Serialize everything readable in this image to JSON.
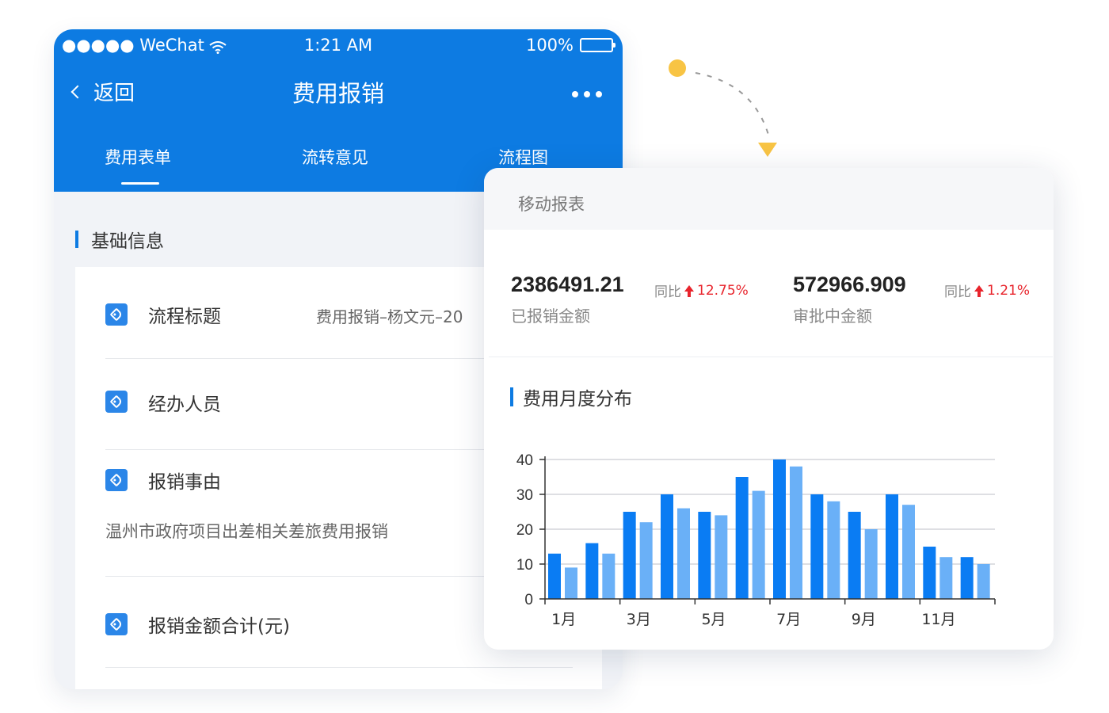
{
  "phone": {
    "status": {
      "carrier": "●●●●● WeChat",
      "time": "1:21 AM",
      "battery": "100%"
    },
    "nav": {
      "back": "返回",
      "title": "费用报销"
    },
    "tabs": [
      {
        "label": "费用表单",
        "active": true
      },
      {
        "label": "流转意见",
        "active": false
      },
      {
        "label": "流程图",
        "active": false
      }
    ],
    "section_title": "基础信息",
    "rows": [
      {
        "label": "流程标题",
        "value": "费用报销–杨文元–20"
      },
      {
        "label": "经办人员",
        "value": ""
      },
      {
        "label": "报销事由",
        "value": ""
      },
      {
        "label": "报销金额合计(元)",
        "value": ""
      }
    ],
    "reason_text": "温州市政府项目出差相关差旅费用报销"
  },
  "report": {
    "title": "移动报表",
    "stats": [
      {
        "value": "2386491.21",
        "label": "已报销金额",
        "yoy_label": "同比",
        "yoy": "12.75%"
      },
      {
        "value": "572966.909",
        "label": "审批中金额",
        "yoy_label": "同比",
        "yoy": "1.21%"
      }
    ],
    "chart_title": "费用月度分布"
  },
  "colors": {
    "primary": "#0d7be2",
    "bar_dark": "#0a7cf3",
    "bar_light": "#6ab0f7",
    "up": "#e8242c",
    "dot": "#f8c444"
  },
  "chart_data": {
    "type": "bar",
    "title": "费用月度分布",
    "categories": [
      "1月",
      "2月",
      "3月",
      "4月",
      "5月",
      "6月",
      "7月",
      "8月",
      "9月",
      "10月",
      "11月",
      "12月"
    ],
    "tick_labels": [
      "1月",
      "3月",
      "5月",
      "7月",
      "9月",
      "11月"
    ],
    "series": [
      {
        "values": [
          13,
          16,
          25,
          30,
          25,
          35,
          40,
          30,
          25,
          30,
          15,
          12
        ]
      },
      {
        "values": [
          9,
          13,
          22,
          26,
          24,
          31,
          38,
          28,
          20,
          27,
          12,
          10
        ]
      }
    ],
    "ylim": [
      0,
      40
    ],
    "yticks": [
      0,
      10,
      20,
      30,
      40
    ],
    "grid": true
  }
}
